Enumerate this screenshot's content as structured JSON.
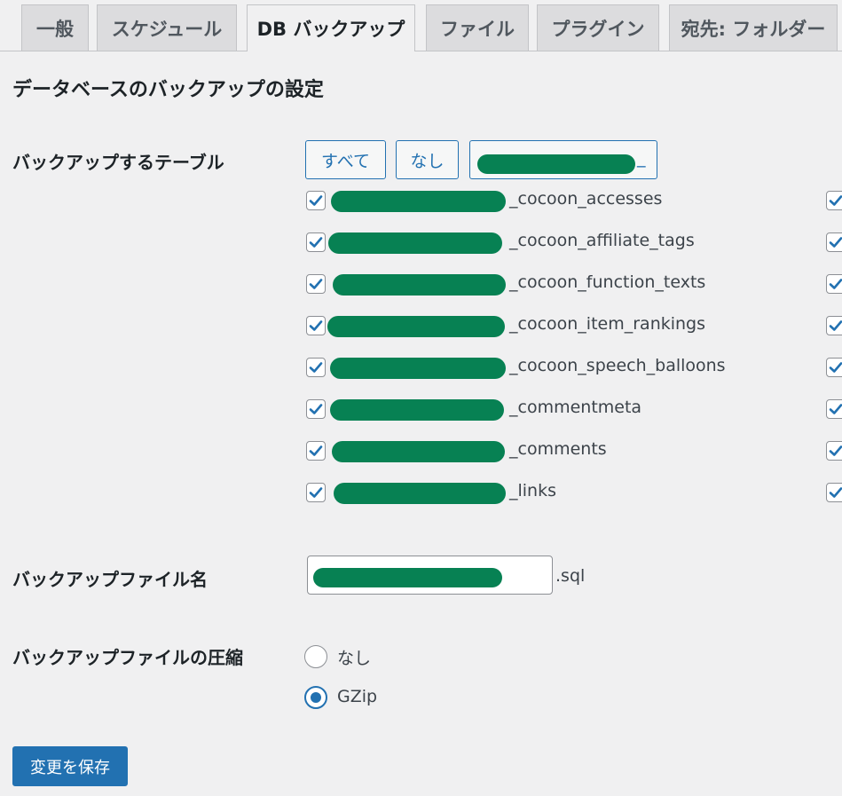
{
  "tabs": [
    {
      "label": "一般",
      "active": false
    },
    {
      "label": "スケジュール",
      "active": false
    },
    {
      "label": "DB バックアップ",
      "active": true
    },
    {
      "label": "ファイル",
      "active": false
    },
    {
      "label": "プラグイン",
      "active": false
    },
    {
      "label": "宛先: フォルダー",
      "active": false
    }
  ],
  "page_title": "データベースのバックアップの設定",
  "tables_section": {
    "label": "バックアップするテーブル",
    "buttons": {
      "all": "すべて",
      "none": "なし",
      "prefix_suffix": "_"
    },
    "rows": [
      {
        "name": "_cocoon_accesses",
        "checked": true
      },
      {
        "name": "_cocoon_affiliate_tags",
        "checked": true
      },
      {
        "name": "_cocoon_function_texts",
        "checked": true
      },
      {
        "name": "_cocoon_item_rankings",
        "checked": true
      },
      {
        "name": "_cocoon_speech_balloons",
        "checked": true
      },
      {
        "name": "_commentmeta",
        "checked": true
      },
      {
        "name": "_comments",
        "checked": true
      },
      {
        "name": "_links",
        "checked": true
      }
    ]
  },
  "filename_section": {
    "label": "バックアップファイル名",
    "suffix": ".sql"
  },
  "compression_section": {
    "label": "バックアップファイルの圧縮",
    "options": [
      {
        "label": "なし",
        "selected": false
      },
      {
        "label": "GZip",
        "selected": true
      }
    ]
  },
  "save_button": "変更を保存",
  "colors": {
    "accent": "#2271b1",
    "redaction": "#078153",
    "background": "#f0f0f1"
  },
  "icons": {
    "checkbox": "checkmark-icon",
    "radio": "radio-dot-icon"
  }
}
